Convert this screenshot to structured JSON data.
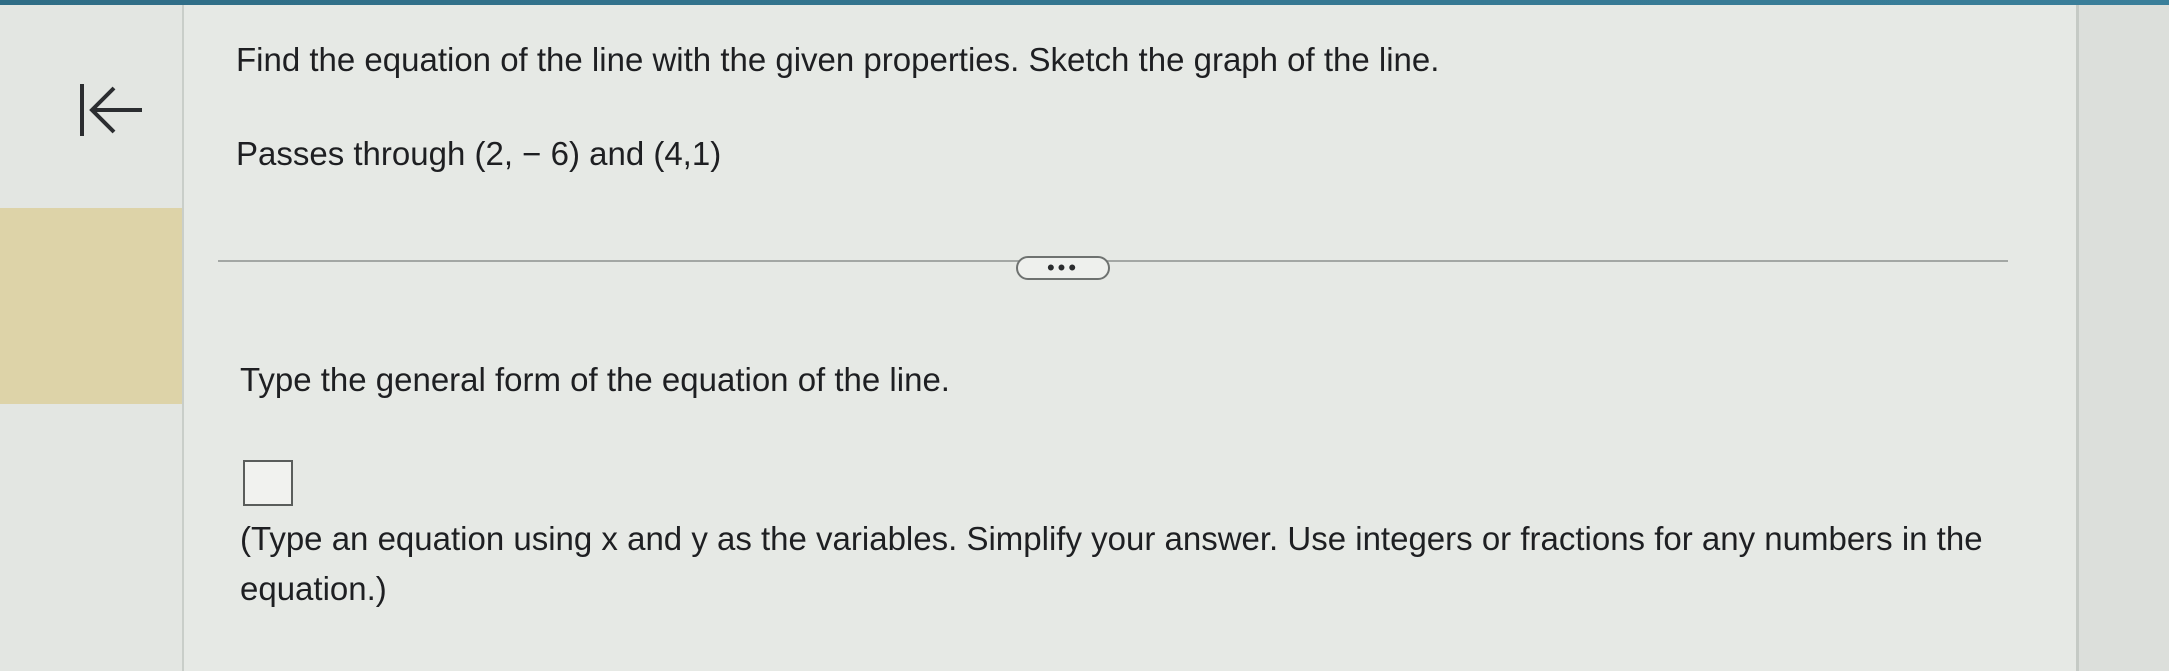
{
  "nav": {
    "back_icon": "first-page-arrow-icon"
  },
  "question": {
    "instruction": "Find the equation of the line with the given properties. Sketch the graph of the line.",
    "given": "Passes through (2, − 6) and (4,1)"
  },
  "divider": {
    "expand_label": "•••"
  },
  "part": {
    "prompt": "Type the general form of the equation of the line.",
    "answer_value": "",
    "hint": "(Type an equation using x and y as the variables. Simplify your answer. Use integers or fractions for any numbers in the equation.)"
  },
  "colors": {
    "top_bar": "#2f6d86",
    "left_highlight": "#ddd3a8",
    "background": "#e6e9e5"
  }
}
